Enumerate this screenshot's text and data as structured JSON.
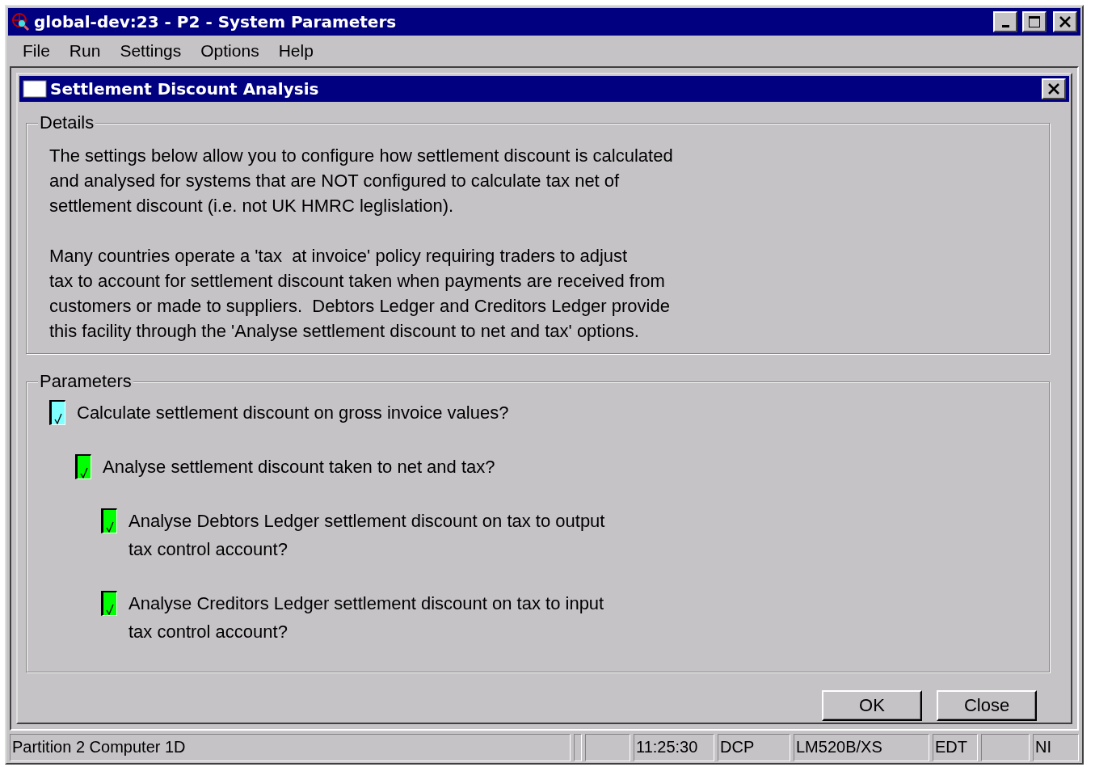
{
  "window": {
    "title": "global-dev:23 - P2 - System Parameters"
  },
  "menu": [
    "File",
    "Run",
    "Settings",
    "Options",
    "Help"
  ],
  "dialog": {
    "title": "Settlement Discount Analysis",
    "details": {
      "title": "Details",
      "paragraphs": [
        "The settings below allow you to configure how settlement discount is calculated\nand analysed for systems that are NOT configured to calculate tax net of\nsettlement discount (i.e. not UK HMRC leglislation).",
        "Many countries operate a 'tax  at invoice' policy requiring traders to adjust\ntax to account for settlement discount taken when payments are received from\ncustomers or made to suppliers.  Debtors Ledger and Creditors Ledger provide\nthis facility through the 'Analyse settlement discount to net and tax' options."
      ]
    },
    "parameters": {
      "title": "Parameters",
      "options": [
        {
          "label": "Calculate settlement discount on gross invoice values?",
          "checked": true,
          "focused": true,
          "children": [
            {
              "label": "Analyse settlement discount taken to net and tax?",
              "checked": true,
              "focused": false,
              "children": [
                {
                  "label": "Analyse Debtors Ledger settlement discount on tax to output\ntax control account?",
                  "checked": true,
                  "focused": false
                },
                {
                  "label": "Analyse Creditors Ledger settlement discount on tax to input\ntax control account?",
                  "checked": true,
                  "focused": false
                }
              ]
            }
          ]
        }
      ]
    },
    "buttons": [
      "OK",
      "Close"
    ]
  },
  "status_bar": [
    "Partition 2 Computer 1D",
    "11:25:30",
    "DCP",
    "LM520B/XS",
    "EDT",
    "NI"
  ]
}
